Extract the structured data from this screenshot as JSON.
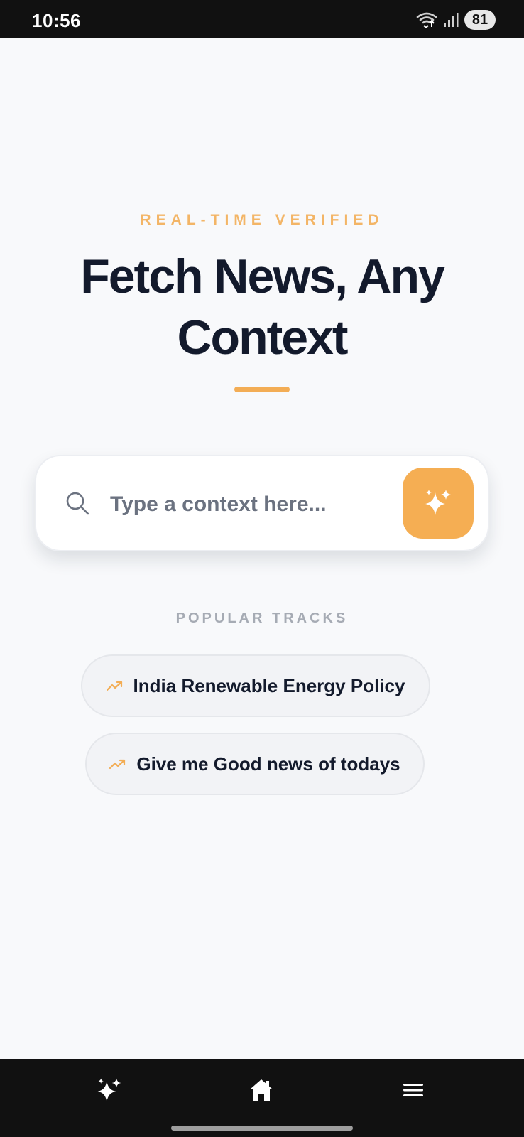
{
  "status_bar": {
    "time": "10:56",
    "battery": "81"
  },
  "hero": {
    "eyebrow": "REAL-TIME VERIFIED",
    "title": "Fetch News, Any Context"
  },
  "search": {
    "placeholder": "Type a context here...",
    "value": "",
    "icon": "search-icon",
    "submit_icon": "sparkles-icon"
  },
  "popular": {
    "label": "POPULAR TRACKS",
    "items": [
      {
        "label": "India Renewable Energy Policy",
        "icon": "trending-up-icon"
      },
      {
        "label": "Give me Good news of todays",
        "icon": "trending-up-icon"
      }
    ]
  },
  "bottom_nav": {
    "items": [
      {
        "icon": "sparkles-icon"
      },
      {
        "icon": "home-icon"
      },
      {
        "icon": "menu-icon"
      }
    ]
  },
  "colors": {
    "accent": "#f5ae53",
    "eyebrow": "#f3b566",
    "heading": "#131a2c",
    "background": "#f8f9fb",
    "bars": "#111111"
  }
}
